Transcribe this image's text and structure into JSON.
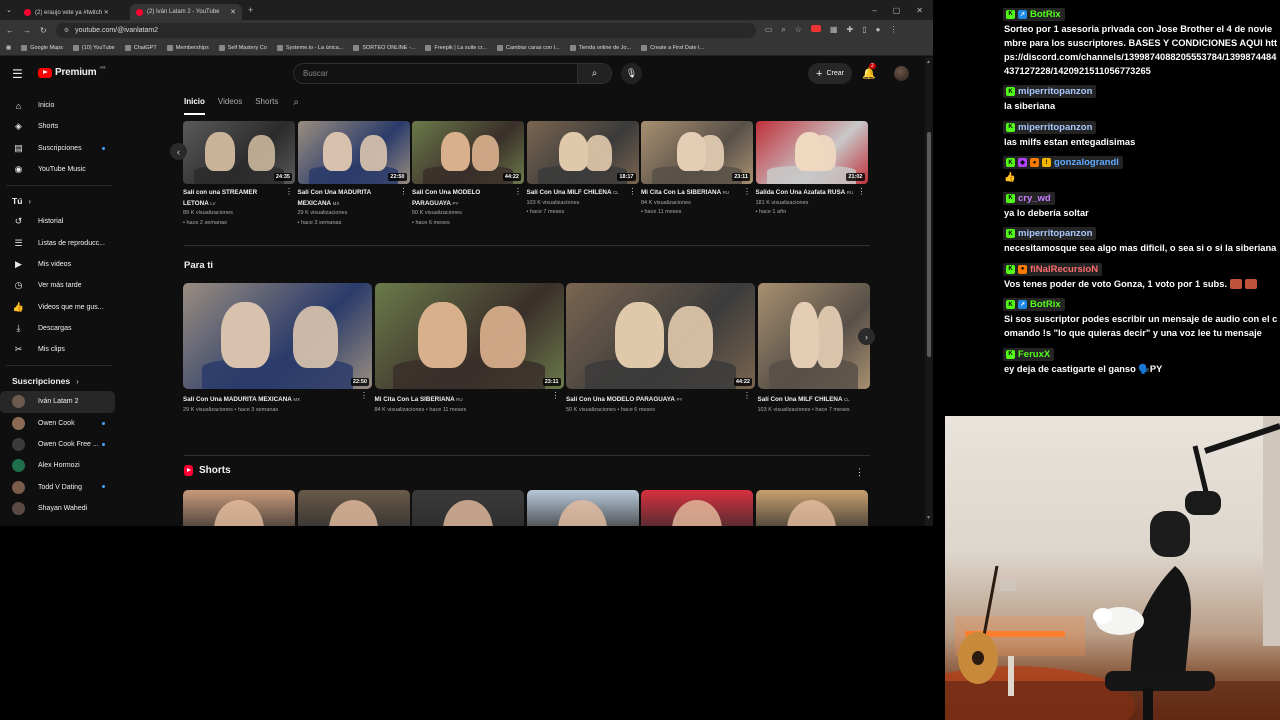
{
  "browser": {
    "tabs": [
      {
        "label": "(2) eraujo vete ya  #twitch ✕"
      },
      {
        "label": "(2) Iván Latam 2 - YouTube"
      }
    ],
    "url": "youtube.com/@ivanlatam2",
    "bookmarks": [
      "Google Maps",
      "(10) YouTube",
      "ChatGPT",
      "Memberships",
      "Self Mastery Co",
      "Systeme.io - La única...",
      "SORTEO ONLINE -...",
      "Freepik | La suite cr...",
      "Cambiar caras con I...",
      "Tienda online de Jo...",
      "Create a First Date I..."
    ]
  },
  "youtube": {
    "logo_text": "Premium",
    "logo_region": "AR",
    "search_placeholder": "Buscar",
    "create_label": "Crear",
    "notifications_count": "2",
    "sidebar": {
      "main": [
        {
          "label": "Inicio",
          "icon": "home-icon"
        },
        {
          "label": "Shorts",
          "icon": "shorts-icon"
        },
        {
          "label": "Suscripciones",
          "icon": "subscriptions-icon"
        },
        {
          "label": "YouTube Music",
          "icon": "music-icon"
        }
      ],
      "you_title": "Tú",
      "you": [
        {
          "label": "Historial",
          "icon": "history-icon"
        },
        {
          "label": "Listas de reproducc...",
          "icon": "playlist-icon"
        },
        {
          "label": "Mis videos",
          "icon": "my-videos-icon"
        },
        {
          "label": "Ver más tarde",
          "icon": "watch-later-icon"
        },
        {
          "label": "Videos que me gus...",
          "icon": "liked-icon"
        },
        {
          "label": "Descargas",
          "icon": "downloads-icon"
        },
        {
          "label": "Mis clips",
          "icon": "clips-icon"
        }
      ],
      "subs_title": "Suscripciones",
      "subs": [
        {
          "label": "Iván Latam 2",
          "color": "#6d5a4e"
        },
        {
          "label": "Owen Cook",
          "color": "#8a6a52"
        },
        {
          "label": "Owen Cook Free ...",
          "color": "#3b3b3b"
        },
        {
          "label": "Alex Hormozi",
          "color": "#1f6f4a"
        },
        {
          "label": "Todd V Dating",
          "color": "#7a5c4a"
        },
        {
          "label": "Shayan Wahedi",
          "color": "#5b4a44"
        }
      ]
    },
    "channel_tabs": [
      "Inicio",
      "Videos",
      "Shorts"
    ],
    "row1": [
      {
        "title": "Salí con una STREAMER LETONA",
        "flag": "LV",
        "views": "89 K visualizaciones",
        "age": "hace 2 semanas",
        "duration": "24:35"
      },
      {
        "title": "Salí Con Una MADURITA MEXICANA",
        "flag": "MX",
        "views": "29 K visualizaciones",
        "age": "hace 3 semanas",
        "duration": "22:50"
      },
      {
        "title": "Salí Con Una MODELO PARAGUAYA",
        "flag": "PY",
        "views": "50 K visualizaciones",
        "age": "hace 6 meses",
        "duration": "44:22"
      },
      {
        "title": "Salí Con Una MILF CHILENA",
        "flag": "CL",
        "views": "103 K visualizaciones",
        "age": "hace 7 meses",
        "duration": "18:17"
      },
      {
        "title": "Mi Cita Con La SIBERIANA",
        "flag": "RU",
        "views": "84 K visualizaciones",
        "age": "hace 11 meses",
        "duration": "23:11"
      },
      {
        "title": "Salida Con Una Azafata RUSA",
        "flag": "RU",
        "views": "181 K visualizaciones",
        "age": "hace 1 año",
        "duration": "21:02"
      }
    ],
    "para_ti_title": "Para ti",
    "row2": [
      {
        "title": "Salí Con Una MADURITA MEXICANA",
        "flag": "MX",
        "views": "29 K visualizaciones",
        "age": "hace 3 semanas",
        "duration": "22:50"
      },
      {
        "title": "Mi Cita Con La SIBERIANA",
        "flag": "RU",
        "views": "84 K visualizaciones",
        "age": "hace 11 meses",
        "duration": "23:11"
      },
      {
        "title": "Salí Con Una MODELO PARAGUAYA",
        "flag": "PY",
        "views": "50 K visualizaciones",
        "age": "hace 6 meses",
        "duration": "44:22"
      },
      {
        "title": "Salí Con Una MILF CHILENA",
        "flag": "CL",
        "views": "103 K visualizaciones",
        "age": "hace 7 meses",
        "duration": ""
      }
    ],
    "shorts_title": "Shorts"
  },
  "chat": [
    {
      "user": "BotRix",
      "color": "#53fc18",
      "badges": [
        "b-green",
        "b-blue"
      ],
      "text": "Sorteo por 1 asesoria privada con Jose Brother el 4 de noviembre para los suscriptores. BASES Y CONDICIONES AQUI https://discord.com/channels/1399874088205553784/1399874484437127228/1420921511056773265"
    },
    {
      "user": "miperritopanzon",
      "color": "#a8c8ff",
      "badges": [
        "b-green"
      ],
      "text": "la siberiana"
    },
    {
      "user": "miperritopanzon",
      "color": "#a8c8ff",
      "badges": [
        "b-green"
      ],
      "text": "las milfs estan entegadisimas"
    },
    {
      "user": "gonzalograndl",
      "color": "#5ea8ff",
      "badges": [
        "b-green",
        "b-purple",
        "b-orange",
        "b-gold"
      ],
      "text": "👍"
    },
    {
      "user": "cry_wd",
      "color": "#c77dff",
      "badges": [
        "b-green"
      ],
      "text": "ya lo debería soltar"
    },
    {
      "user": "miperritopanzon",
      "color": "#a8c8ff",
      "badges": [
        "b-green"
      ],
      "text": "necesitamosque sea algo mas dificil, o sea si o si la siberiana"
    },
    {
      "user": "fiNalRecursioN",
      "color": "#ff6b6b",
      "badges": [
        "b-green",
        "b-orange"
      ],
      "text": "Vos tenes poder de voto Gonza, 1 voto por 1 subs.",
      "emotes": 2
    },
    {
      "user": "BotRix",
      "color": "#53fc18",
      "badges": [
        "b-green",
        "b-blue"
      ],
      "text": "Si sos suscriptor podes escribir un mensaje de audio con el comando !s \"lo que quieras decir\" y una voz lee tu mensaje"
    },
    {
      "user": "FeruxX",
      "color": "#53fc18",
      "badges": [
        "b-green"
      ],
      "text": "ey deja de castigarte el ganso 🗣️PY"
    }
  ]
}
